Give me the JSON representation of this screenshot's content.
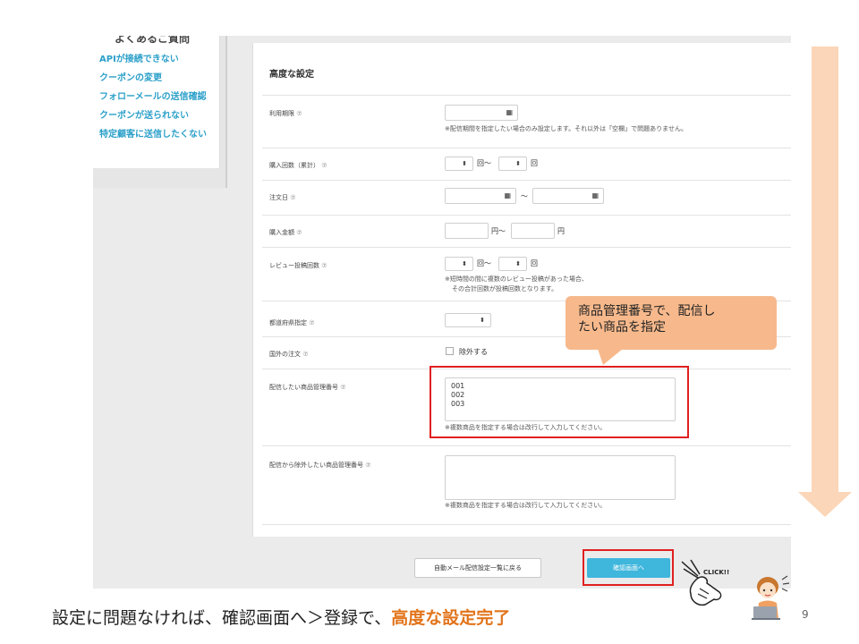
{
  "sidebar": {
    "heading": "よくあるご質問",
    "items": [
      "APIが接続できない",
      "クーポンの変更",
      "フォローメールの送信確認",
      "クーポンが送られない",
      "特定顧客に送信したくない"
    ]
  },
  "panel": {
    "title": "高度な設定",
    "help_mark": "⑦",
    "rows": {
      "period": {
        "label": "利用期限",
        "note": "※配信期間を指定したい場合のみ設定します。それ以外は「空欄」で問題ありません。"
      },
      "purchase_count": {
        "label": "購入回数（累計）",
        "unit1": "回～",
        "unit2": "回"
      },
      "order_date": {
        "label": "注文日",
        "sep": "～"
      },
      "amount": {
        "label": "購入金額",
        "unit1": "円～",
        "unit2": "円"
      },
      "review_count": {
        "label": "レビュー投稿回数",
        "unit1": "回～",
        "unit2": "回",
        "note1": "※短時間の間に複数のレビュー投稿があった場合、",
        "note2": "その合計回数が投稿回数となります。"
      },
      "prefecture": {
        "label": "都道府県指定"
      },
      "overseas": {
        "label": "国外の注文",
        "checkbox_label": "除外する"
      },
      "product_ids": {
        "label": "配信したい商品管理番号",
        "values": [
          "001",
          "002",
          "003"
        ],
        "note": "※複数商品を指定する場合は改行して入力してください。"
      },
      "exclude_ids": {
        "label": "配信から除外したい商品管理番号",
        "note": "※複数商品を指定する場合は改行して入力してください。"
      }
    },
    "buttons": {
      "back": "自動メール配信設定一覧に戻る",
      "confirm": "確認画面へ"
    }
  },
  "callout": {
    "line1": "商品管理番号で、配信し",
    "line2": "たい商品を指定"
  },
  "click_label": "CLICK!!",
  "caption": {
    "main": "設定に問題なければ、確認画面へ＞登録で、",
    "highlight": "高度な設定完了"
  },
  "page_number": "9",
  "colors": {
    "link": "#2a9fc9",
    "confirm_button": "#3fb6dc",
    "highlight_box": "#e02020",
    "callout": "#f7b98c",
    "arrow": "#fbd6b8",
    "caption_highlight": "#e2741b"
  }
}
